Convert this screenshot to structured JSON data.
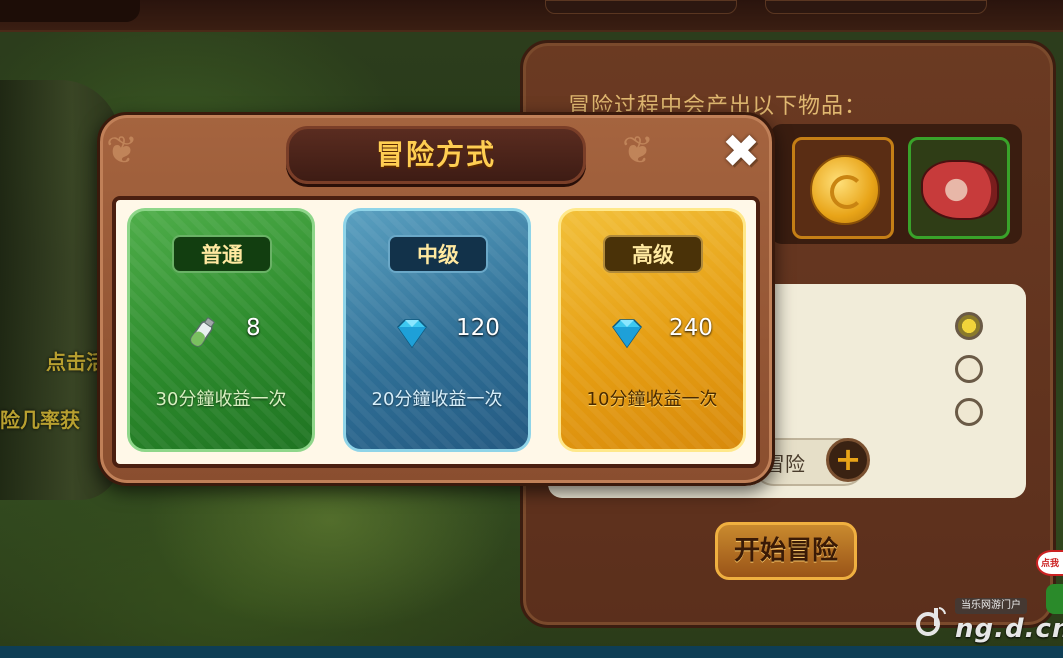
{
  "background": {
    "left_text_1": "点击活",
    "left_text_2": "险几率获"
  },
  "right_panel": {
    "heading": "冒险过程中会产出以下物品：",
    "items": [
      {
        "icon": "gold-coin-icon",
        "border": "#c57f16"
      },
      {
        "icon": "meat-icon",
        "border": "#39a22a"
      }
    ],
    "options_selected": 0,
    "input_label": "冒险",
    "plus_label": "+",
    "start_button": "开始冒险"
  },
  "modal": {
    "title": "冒险方式",
    "close_label": "✖",
    "cards": [
      {
        "label": "普通",
        "cost_icon": "potion-bottle-icon",
        "cost": "8",
        "desc": "30分鐘收益一次",
        "color": "#2c8a2c"
      },
      {
        "label": "中级",
        "cost_icon": "diamond-icon",
        "cost": "120",
        "desc": "20分鐘收益一次",
        "color": "#2f6f96"
      },
      {
        "label": "高级",
        "cost_icon": "diamond-icon",
        "cost": "240",
        "desc": "10分鐘收益一次",
        "color": "#e59d12"
      }
    ]
  },
  "watermark": {
    "badge": "当乐网游门户",
    "text": "ng.d.cn",
    "mascot_text": "点我"
  }
}
